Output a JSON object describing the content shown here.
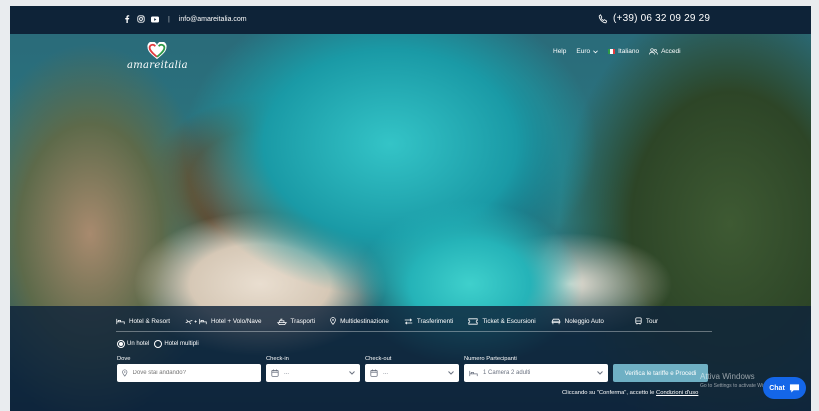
{
  "topbar": {
    "email": "info@amareitalia.com",
    "separator": "|",
    "phone": "(+39) 06 32 09 29 29",
    "social_icons": [
      "facebook-icon",
      "instagram-icon",
      "youtube-icon"
    ]
  },
  "logo": {
    "text": "amareitalia"
  },
  "nav": {
    "help": "Help",
    "currency": "Euro",
    "language": "Italiano",
    "login": "Accedi"
  },
  "tabs": [
    {
      "label": "Hotel & Resort"
    },
    {
      "label": "Hotel + Volo/Nave"
    },
    {
      "label": "Trasporti"
    },
    {
      "label": "Multidestinazione"
    },
    {
      "label": "Trasferimenti"
    },
    {
      "label": "Ticket & Escursioni"
    },
    {
      "label": "Noleggio Auto"
    },
    {
      "label": "Tour"
    }
  ],
  "search": {
    "radio_single": "Un hotel",
    "radio_multi": "Hotel multipli",
    "where_label": "Dove",
    "where_placeholder": "Dove stai andando?",
    "checkin_label": "Check-in",
    "checkin_value": "...",
    "checkout_label": "Check-out",
    "checkout_value": "...",
    "guests_label": "Numero Partecipanti",
    "guests_value": "1 Camera 2 adulti",
    "submit_label": "Verifica le tariffe e Procedi",
    "terms_prefix": "Cliccando su \"Conferma\", accetto le",
    "terms_link": "Condizioni d'uso"
  },
  "watermark": {
    "title": "Attiva Windows",
    "subtitle": "Go to Settings to activate Windows."
  },
  "chat": {
    "label": "Chat"
  },
  "colors": {
    "topbar_bg": "#0e2338",
    "panel_bg": "#0f233a",
    "cta": "#6fb0c4",
    "chat": "#1466e8",
    "logo_heart_red": "#e03a3e",
    "logo_heart_green": "#2e9a47"
  }
}
